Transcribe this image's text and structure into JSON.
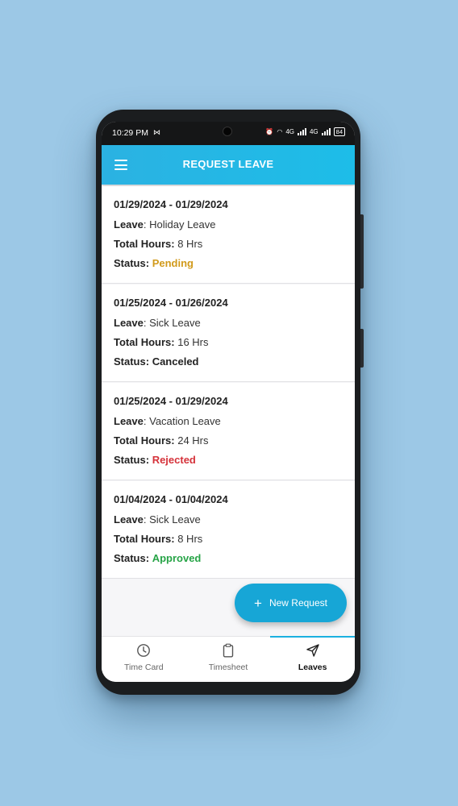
{
  "status_bar": {
    "time": "10:29 PM",
    "message_icon": "M",
    "network_1": "4G",
    "network_2": "4G",
    "battery": "84"
  },
  "app_bar": {
    "title": "REQUEST LEAVE",
    "menu_icon": "hamburger-icon"
  },
  "labels": {
    "leave": "Leave",
    "total_hours": "Total Hours:",
    "status": "Status:"
  },
  "requests": [
    {
      "dates": "01/29/2024 - 01/29/2024",
      "leave": "Holiday Leave",
      "hours": "8 Hrs",
      "status": "Pending"
    },
    {
      "dates": "01/25/2024 - 01/26/2024",
      "leave": "Sick Leave",
      "hours": "16 Hrs",
      "status": "Canceled"
    },
    {
      "dates": "01/25/2024 - 01/29/2024",
      "leave": "Vacation Leave",
      "hours": "24 Hrs",
      "status": "Rejected"
    },
    {
      "dates": "01/04/2024 - 01/04/2024",
      "leave": "Sick Leave",
      "hours": "8 Hrs",
      "status": "Approved"
    }
  ],
  "fab": {
    "label": "New Request",
    "icon": "plus-icon"
  },
  "bottom_nav": {
    "items": [
      {
        "label": "Time Card",
        "icon": "clock-icon"
      },
      {
        "label": "Timesheet",
        "icon": "clipboard-icon"
      },
      {
        "label": "Leaves",
        "icon": "send-icon"
      }
    ],
    "active": "Leaves"
  },
  "colors": {
    "background": "#9cc8e6",
    "app_bar": "#1dbde8",
    "fab": "#17a6d6",
    "pending": "#d19a1b",
    "rejected": "#d5323a",
    "approved": "#27a447"
  }
}
